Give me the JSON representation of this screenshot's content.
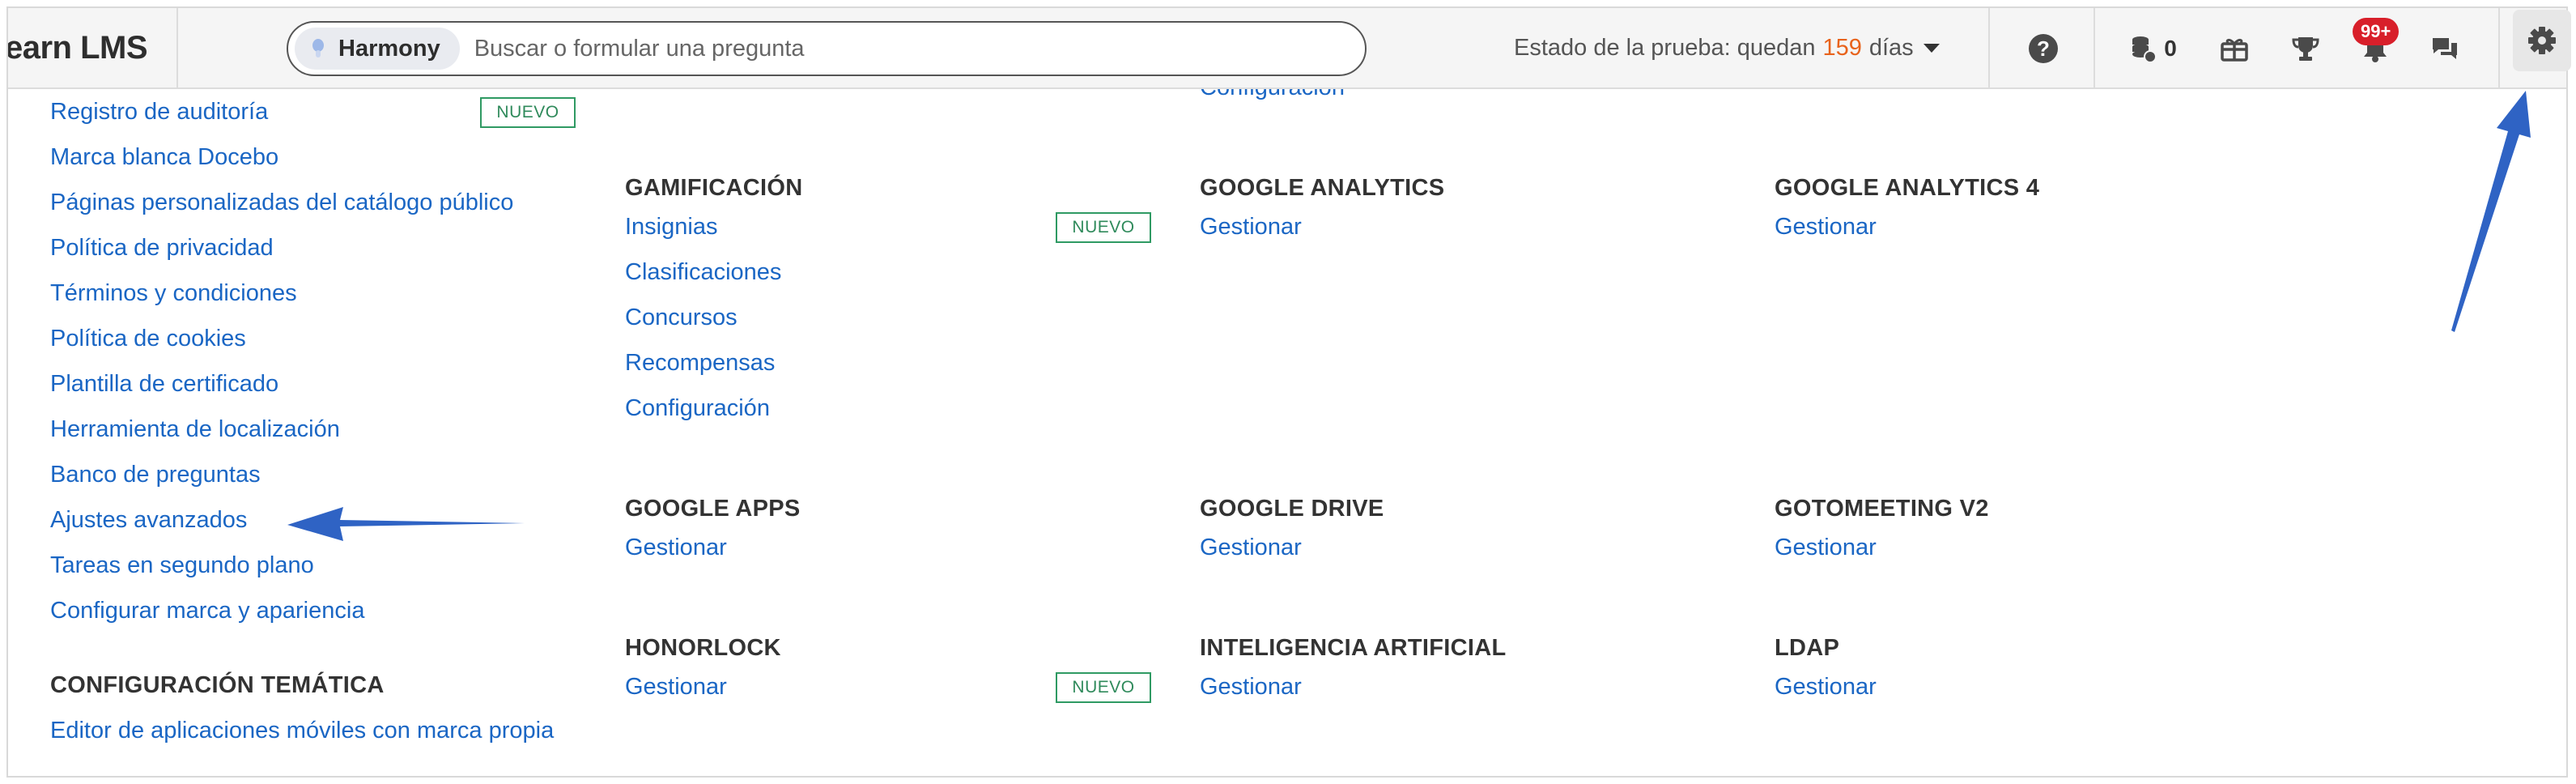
{
  "brand": {
    "name": "earn LMS"
  },
  "search": {
    "assistant": "Harmony",
    "placeholder": "Buscar o formular una pregunta"
  },
  "trial": {
    "prefix": "Estado de la prueba: quedan",
    "days": "159",
    "suffix": "días"
  },
  "header_icons": {
    "help": "?",
    "coins_count": "0",
    "notifications_badge": "99+"
  },
  "left_column": {
    "partial_item": "",
    "items": [
      "Registro de auditoría",
      "Marca blanca Docebo",
      "Páginas personalizadas del catálogo público",
      "Política de privacidad",
      "Términos y condiciones",
      "Política de cookies",
      "Plantilla de certificado",
      "Herramienta de localización",
      "Banco de preguntas",
      "Ajustes avanzados",
      "Tareas en segundo plano",
      "Configurar marca y apariencia"
    ],
    "theme_heading": "CONFIGURACIÓN TEMÁTICA",
    "theme_item": "Editor de aplicaciones móviles con marca propia"
  },
  "badge_label": "NUEVO",
  "top_partial_link": "Configuración",
  "sections": {
    "gamificacion": {
      "title": "GAMIFICACIÓN",
      "items": [
        "Insignias",
        "Clasificaciones",
        "Concursos",
        "Recompensas",
        "Configuración"
      ]
    },
    "google_analytics": {
      "title": "GOOGLE ANALYTICS",
      "link": "Gestionar"
    },
    "google_analytics_4": {
      "title": "GOOGLE ANALYTICS 4",
      "link": "Gestionar"
    },
    "google_apps": {
      "title": "GOOGLE APPS",
      "link": "Gestionar"
    },
    "google_drive": {
      "title": "GOOGLE DRIVE",
      "link": "Gestionar"
    },
    "gotomeeting": {
      "title": "GOTOMEETING V2",
      "link": "Gestionar"
    },
    "honorlock": {
      "title": "HONORLOCK",
      "link": "Gestionar"
    },
    "inteligencia_artificial": {
      "title": "INTELIGENCIA ARTIFICIAL",
      "link": "Gestionar"
    },
    "ldap": {
      "title": "LDAP",
      "link": "Gestionar"
    }
  },
  "colors": {
    "link": "#1a66c4",
    "accent_days": "#e8631c",
    "badge": "#d81f2a",
    "nuevo": "#2f9a63",
    "arrow": "#2f63c4"
  }
}
